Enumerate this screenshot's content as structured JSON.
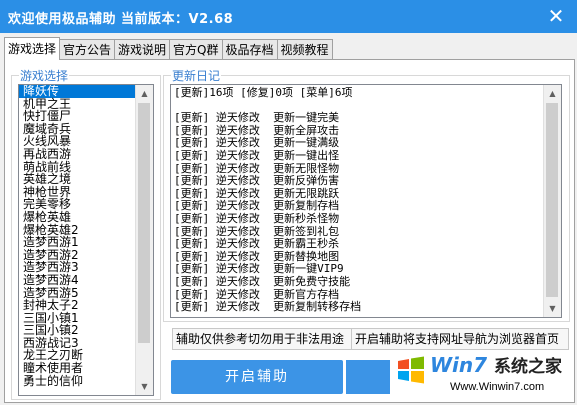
{
  "window": {
    "title": "欢迎使用极品辅助  当前版本：V2.68",
    "close_symbol": "✕"
  },
  "tabs": [
    {
      "label": "游戏选择",
      "active": true
    },
    {
      "label": "官方公告",
      "active": false
    },
    {
      "label": "游戏说明",
      "active": false
    },
    {
      "label": "官方Q群",
      "active": false
    },
    {
      "label": "极品存档",
      "active": false
    },
    {
      "label": "视频教程",
      "active": false
    }
  ],
  "game_select": {
    "group_label": "游戏选择",
    "items": [
      "降妖传",
      "机甲之王",
      "快打僵尸",
      "魔域奇兵",
      "火线风暴",
      "再战西游",
      "萌战前线",
      "英雄之境",
      "神枪世界",
      "完美零移",
      "爆枪英雄",
      "爆枪英雄2",
      "造梦西游1",
      "造梦西游2",
      "造梦西游3",
      "造梦西游4",
      "造梦西游5",
      "封神太子2",
      "三国小镇1",
      "三国小镇2",
      "西游战记3",
      "龙王之刃断",
      "瞳术使用者",
      "勇士的信仰"
    ],
    "selected_index": 0
  },
  "changelog": {
    "group_label": "更新日记",
    "lines": [
      "[更新]16项 [修复]0项 [菜单]6项",
      "",
      "[更新] 逆天修改  更新一键完美",
      "[更新] 逆天修改  更新全屏攻击",
      "[更新] 逆天修改  更新一键满级",
      "[更新] 逆天修改  更新一键出怪",
      "[更新] 逆天修改  更新无限怪物",
      "[更新] 逆天修改  更新反弹伤害",
      "[更新] 逆天修改  更新无限跳跃",
      "[更新] 逆天修改  更新复制存档",
      "[更新] 逆天修改  更新秒杀怪物",
      "[更新] 逆天修改  更新签到礼包",
      "[更新] 逆天修改  更新霸王秒杀",
      "[更新] 逆天修改  更新替换地图",
      "[更新] 逆天修改  更新一键VIP9",
      "[更新] 逆天修改  更新免费守技能",
      "[更新] 逆天修改  更新官方存档",
      "[更新] 逆天修改  更新复制转移存档"
    ]
  },
  "notices": {
    "disclaimer": "辅助仅供参考切勿用于非法用途",
    "browser_homepage": "开启辅助将支持网址导航为浏览器首页"
  },
  "buttons": {
    "start": "开启辅助"
  },
  "watermark": {
    "brand_en": "Win",
    "brand_digit": "7",
    "brand_cn": "系统之家",
    "url": "Www.Winwin7.com"
  }
}
